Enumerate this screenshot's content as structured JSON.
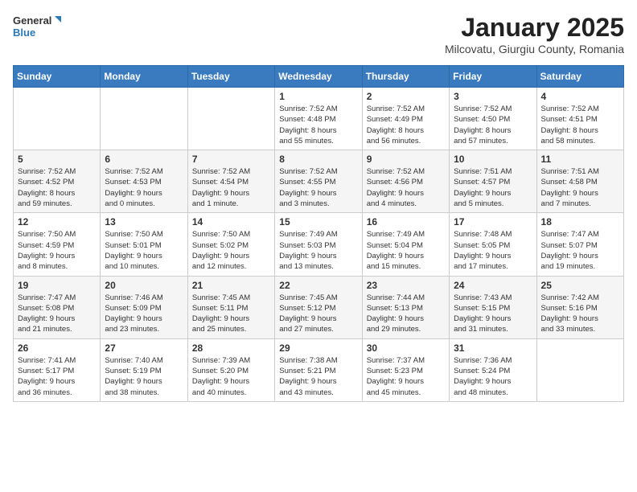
{
  "header": {
    "logo_line1": "General",
    "logo_line2": "Blue",
    "title": "January 2025",
    "subtitle": "Milcovatu, Giurgiu County, Romania"
  },
  "weekdays": [
    "Sunday",
    "Monday",
    "Tuesday",
    "Wednesday",
    "Thursday",
    "Friday",
    "Saturday"
  ],
  "weeks": [
    [
      {
        "day": "",
        "info": ""
      },
      {
        "day": "",
        "info": ""
      },
      {
        "day": "",
        "info": ""
      },
      {
        "day": "1",
        "info": "Sunrise: 7:52 AM\nSunset: 4:48 PM\nDaylight: 8 hours\nand 55 minutes."
      },
      {
        "day": "2",
        "info": "Sunrise: 7:52 AM\nSunset: 4:49 PM\nDaylight: 8 hours\nand 56 minutes."
      },
      {
        "day": "3",
        "info": "Sunrise: 7:52 AM\nSunset: 4:50 PM\nDaylight: 8 hours\nand 57 minutes."
      },
      {
        "day": "4",
        "info": "Sunrise: 7:52 AM\nSunset: 4:51 PM\nDaylight: 8 hours\nand 58 minutes."
      }
    ],
    [
      {
        "day": "5",
        "info": "Sunrise: 7:52 AM\nSunset: 4:52 PM\nDaylight: 8 hours\nand 59 minutes."
      },
      {
        "day": "6",
        "info": "Sunrise: 7:52 AM\nSunset: 4:53 PM\nDaylight: 9 hours\nand 0 minutes."
      },
      {
        "day": "7",
        "info": "Sunrise: 7:52 AM\nSunset: 4:54 PM\nDaylight: 9 hours\nand 1 minute."
      },
      {
        "day": "8",
        "info": "Sunrise: 7:52 AM\nSunset: 4:55 PM\nDaylight: 9 hours\nand 3 minutes."
      },
      {
        "day": "9",
        "info": "Sunrise: 7:52 AM\nSunset: 4:56 PM\nDaylight: 9 hours\nand 4 minutes."
      },
      {
        "day": "10",
        "info": "Sunrise: 7:51 AM\nSunset: 4:57 PM\nDaylight: 9 hours\nand 5 minutes."
      },
      {
        "day": "11",
        "info": "Sunrise: 7:51 AM\nSunset: 4:58 PM\nDaylight: 9 hours\nand 7 minutes."
      }
    ],
    [
      {
        "day": "12",
        "info": "Sunrise: 7:50 AM\nSunset: 4:59 PM\nDaylight: 9 hours\nand 8 minutes."
      },
      {
        "day": "13",
        "info": "Sunrise: 7:50 AM\nSunset: 5:01 PM\nDaylight: 9 hours\nand 10 minutes."
      },
      {
        "day": "14",
        "info": "Sunrise: 7:50 AM\nSunset: 5:02 PM\nDaylight: 9 hours\nand 12 minutes."
      },
      {
        "day": "15",
        "info": "Sunrise: 7:49 AM\nSunset: 5:03 PM\nDaylight: 9 hours\nand 13 minutes."
      },
      {
        "day": "16",
        "info": "Sunrise: 7:49 AM\nSunset: 5:04 PM\nDaylight: 9 hours\nand 15 minutes."
      },
      {
        "day": "17",
        "info": "Sunrise: 7:48 AM\nSunset: 5:05 PM\nDaylight: 9 hours\nand 17 minutes."
      },
      {
        "day": "18",
        "info": "Sunrise: 7:47 AM\nSunset: 5:07 PM\nDaylight: 9 hours\nand 19 minutes."
      }
    ],
    [
      {
        "day": "19",
        "info": "Sunrise: 7:47 AM\nSunset: 5:08 PM\nDaylight: 9 hours\nand 21 minutes."
      },
      {
        "day": "20",
        "info": "Sunrise: 7:46 AM\nSunset: 5:09 PM\nDaylight: 9 hours\nand 23 minutes."
      },
      {
        "day": "21",
        "info": "Sunrise: 7:45 AM\nSunset: 5:11 PM\nDaylight: 9 hours\nand 25 minutes."
      },
      {
        "day": "22",
        "info": "Sunrise: 7:45 AM\nSunset: 5:12 PM\nDaylight: 9 hours\nand 27 minutes."
      },
      {
        "day": "23",
        "info": "Sunrise: 7:44 AM\nSunset: 5:13 PM\nDaylight: 9 hours\nand 29 minutes."
      },
      {
        "day": "24",
        "info": "Sunrise: 7:43 AM\nSunset: 5:15 PM\nDaylight: 9 hours\nand 31 minutes."
      },
      {
        "day": "25",
        "info": "Sunrise: 7:42 AM\nSunset: 5:16 PM\nDaylight: 9 hours\nand 33 minutes."
      }
    ],
    [
      {
        "day": "26",
        "info": "Sunrise: 7:41 AM\nSunset: 5:17 PM\nDaylight: 9 hours\nand 36 minutes."
      },
      {
        "day": "27",
        "info": "Sunrise: 7:40 AM\nSunset: 5:19 PM\nDaylight: 9 hours\nand 38 minutes."
      },
      {
        "day": "28",
        "info": "Sunrise: 7:39 AM\nSunset: 5:20 PM\nDaylight: 9 hours\nand 40 minutes."
      },
      {
        "day": "29",
        "info": "Sunrise: 7:38 AM\nSunset: 5:21 PM\nDaylight: 9 hours\nand 43 minutes."
      },
      {
        "day": "30",
        "info": "Sunrise: 7:37 AM\nSunset: 5:23 PM\nDaylight: 9 hours\nand 45 minutes."
      },
      {
        "day": "31",
        "info": "Sunrise: 7:36 AM\nSunset: 5:24 PM\nDaylight: 9 hours\nand 48 minutes."
      },
      {
        "day": "",
        "info": ""
      }
    ]
  ]
}
